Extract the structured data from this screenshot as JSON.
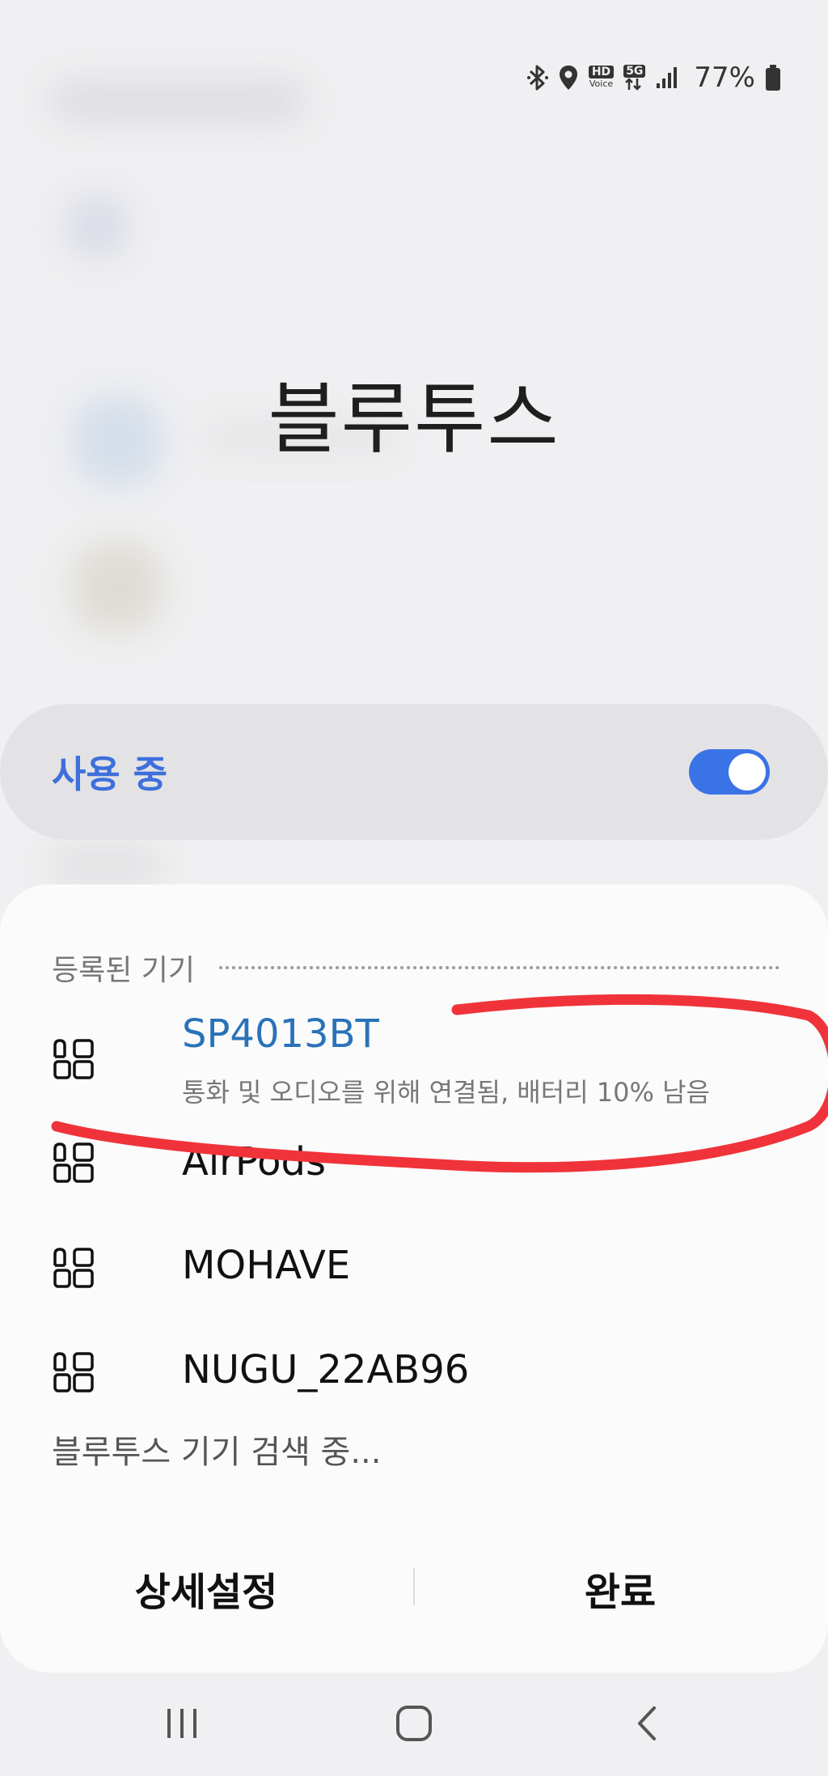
{
  "status_bar": {
    "hd_label": "HD",
    "voice_label": "Voice",
    "network_label": "5G",
    "battery_percent": "77%",
    "icons": [
      "bluetooth-icon",
      "location-icon",
      "hd-voice-icon",
      "5g-icon",
      "signal-icon",
      "battery-icon"
    ]
  },
  "header": {
    "title": "블루투스"
  },
  "toggle": {
    "label": "사용 중",
    "state": "on",
    "accent_color": "#3a73e6"
  },
  "paired_devices": {
    "section_title": "등록된 기기",
    "items": [
      {
        "name": "SP4013BT",
        "status": "통화 및 오디오를 위해 연결됨, 배터리 10% 남음",
        "connected": true,
        "icon": "device-icon"
      },
      {
        "name": "AirPods",
        "status": "",
        "connected": false,
        "icon": "device-icon"
      },
      {
        "name": "MOHAVE",
        "status": "",
        "connected": false,
        "icon": "device-icon"
      },
      {
        "name": "NUGU_22AB96",
        "status": "",
        "connected": false,
        "icon": "device-icon"
      }
    ]
  },
  "scan": {
    "status_text": "블루투스 기기 검색 중..."
  },
  "buttons": {
    "advanced_label": "상세설정",
    "done_label": "완료"
  },
  "nav": {
    "icons": [
      "recent-apps-icon",
      "home-icon",
      "back-icon"
    ]
  },
  "colors": {
    "connected_text": "#2a72b8",
    "annotation_stroke": "#f0333a"
  }
}
